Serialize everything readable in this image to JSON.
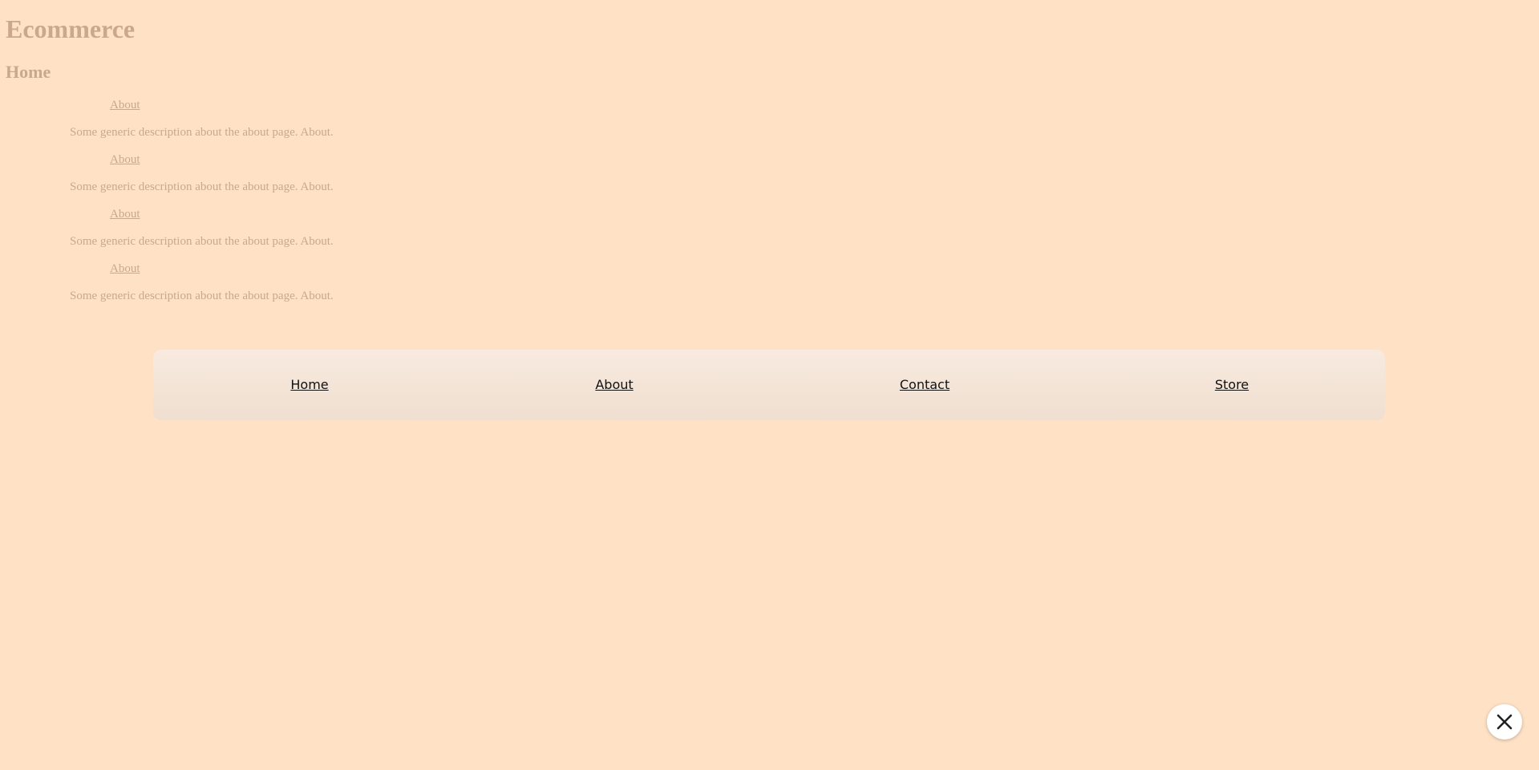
{
  "header": {
    "title": "Ecommerce",
    "page_heading": "Home"
  },
  "items": [
    {
      "link": "About",
      "description": "Some generic description about the about page. About."
    },
    {
      "link": "About",
      "description": "Some generic description about the about page. About."
    },
    {
      "link": "About",
      "description": "Some generic description about the about page. About."
    },
    {
      "link": "About",
      "description": "Some generic description about the about page. About."
    }
  ],
  "nav": {
    "links": [
      "Home",
      "About",
      "Contact",
      "Store"
    ]
  },
  "close_button": {
    "icon": "close-icon"
  },
  "colors": {
    "background": "#FFE2C6",
    "muted_text": "#C9A88C",
    "nav_text": "#111111",
    "nav_bg": "#F4E4D8"
  }
}
